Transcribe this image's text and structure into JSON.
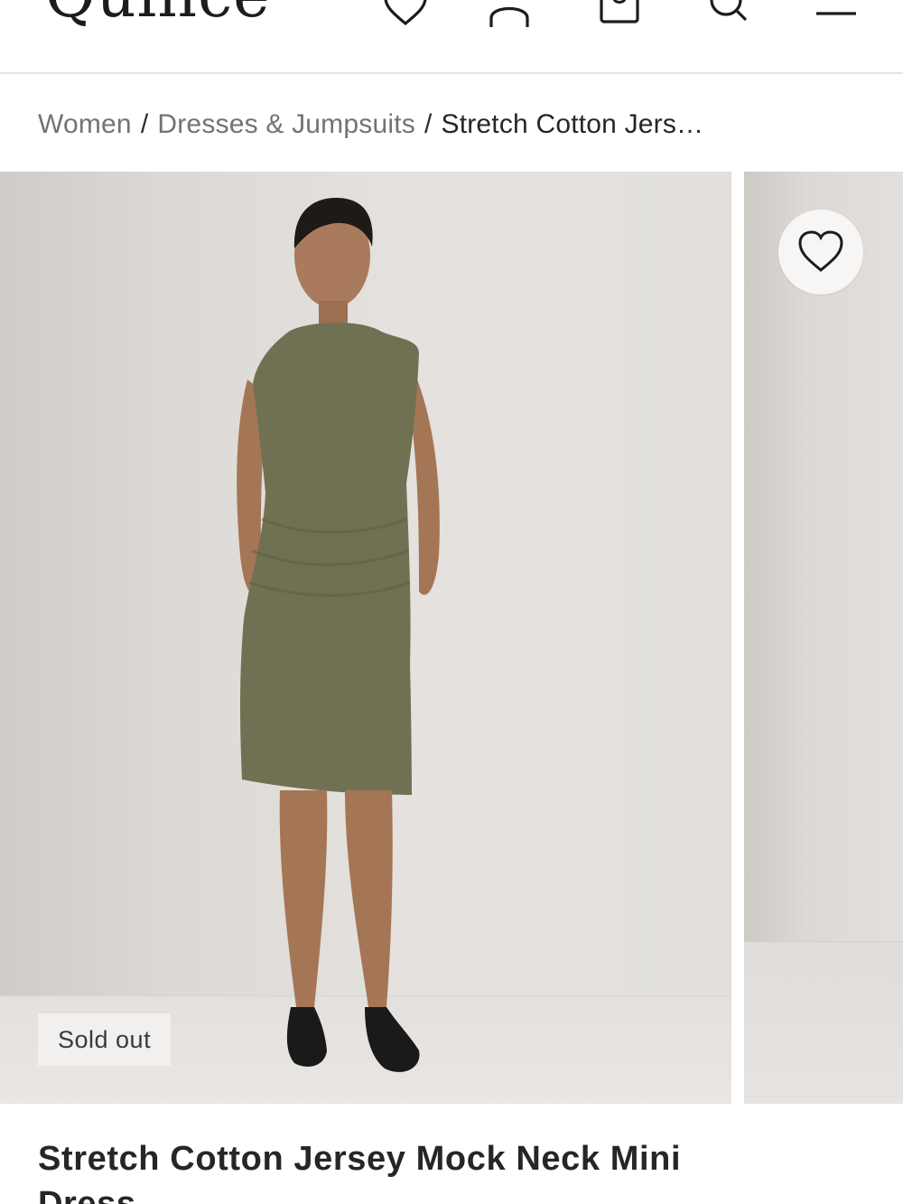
{
  "header": {
    "brand": "Quince",
    "icons": [
      "heart-icon",
      "account-icon",
      "bag-icon",
      "search-icon",
      "menu-icon"
    ]
  },
  "breadcrumb": {
    "items": [
      "Women",
      "Dresses & Jumpsuits"
    ],
    "current": "Stretch Cotton Jers…"
  },
  "gallery": {
    "badge": "Sold out",
    "favorite_icon": "heart-icon"
  },
  "product": {
    "title": "Stretch Cotton Jersey Mock Neck Mini Dress"
  },
  "colors": {
    "text": "#262626",
    "muted": "#737373",
    "divider": "#e3e3e3",
    "dress": "#6f7152",
    "background_photo": "#e2dfdc"
  }
}
